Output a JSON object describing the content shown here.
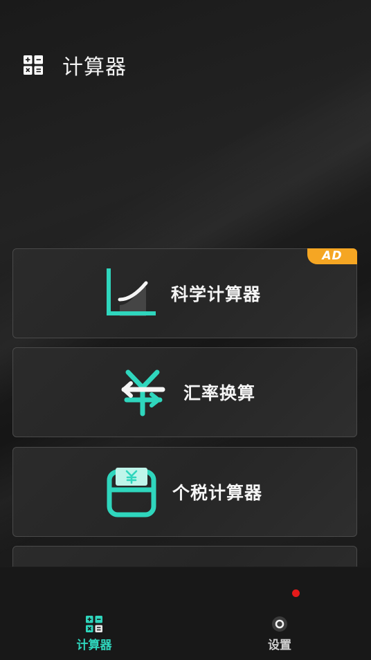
{
  "header": {
    "title": "计算器",
    "icon": "calculator-grid-icon"
  },
  "tools": [
    {
      "label": "科学计算器",
      "icon": "curve-chart-icon",
      "badge": "AD"
    },
    {
      "label": "汇率换算",
      "icon": "yen-exchange-icon"
    },
    {
      "label": "个税计算器",
      "icon": "wallet-yen-icon"
    }
  ],
  "nav": [
    {
      "label": "计算器",
      "icon": "calculator-grid-icon",
      "active": true
    },
    {
      "label": "设置",
      "icon": "settings-circle-icon",
      "active": false
    }
  ],
  "colors": {
    "accent": "#2fd6bd",
    "badge": "#f5a623",
    "notification": "#e51a1a",
    "nav_inactive": "#cfcfcf"
  }
}
